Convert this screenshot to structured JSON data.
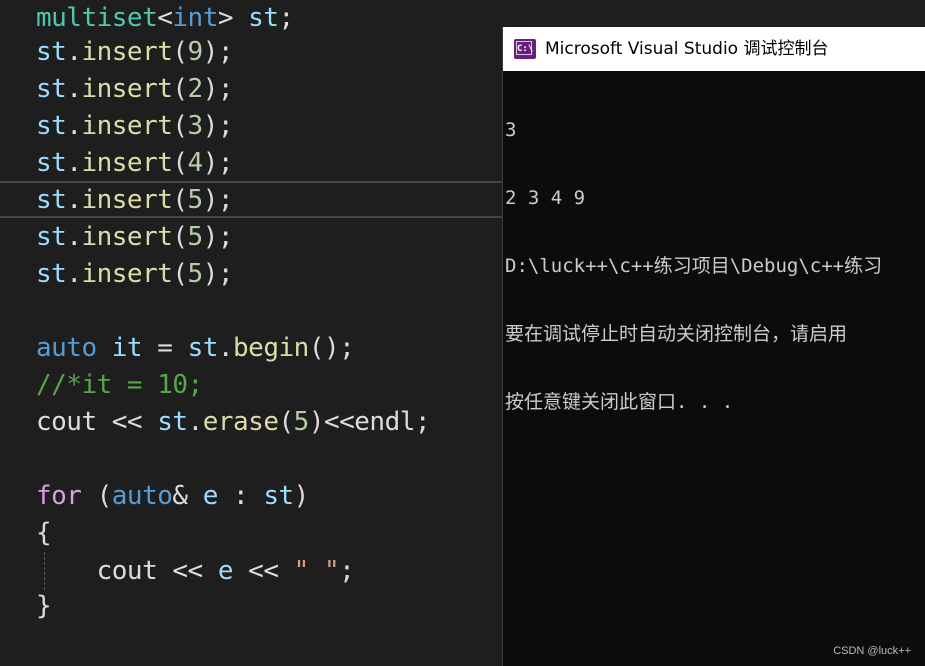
{
  "code_lines": [
    [
      {
        "t": "multiset",
        "c": "type"
      },
      {
        "t": "<",
        "c": "pl"
      },
      {
        "t": "int",
        "c": "kw"
      },
      {
        "t": "> ",
        "c": "pl"
      },
      {
        "t": "st",
        "c": "id"
      },
      {
        "t": ";",
        "c": "pl"
      }
    ],
    [
      {
        "t": "st",
        "c": "id"
      },
      {
        "t": ".",
        "c": "pl"
      },
      {
        "t": "insert",
        "c": "fn"
      },
      {
        "t": "(",
        "c": "pl"
      },
      {
        "t": "9",
        "c": "num"
      },
      {
        "t": ");",
        "c": "pl"
      }
    ],
    [
      {
        "t": "st",
        "c": "id"
      },
      {
        "t": ".",
        "c": "pl"
      },
      {
        "t": "insert",
        "c": "fn"
      },
      {
        "t": "(",
        "c": "pl"
      },
      {
        "t": "2",
        "c": "num"
      },
      {
        "t": ");",
        "c": "pl"
      }
    ],
    [
      {
        "t": "st",
        "c": "id"
      },
      {
        "t": ".",
        "c": "pl"
      },
      {
        "t": "insert",
        "c": "fn"
      },
      {
        "t": "(",
        "c": "pl"
      },
      {
        "t": "3",
        "c": "num"
      },
      {
        "t": ");",
        "c": "pl"
      }
    ],
    [
      {
        "t": "st",
        "c": "id"
      },
      {
        "t": ".",
        "c": "pl"
      },
      {
        "t": "insert",
        "c": "fn"
      },
      {
        "t": "(",
        "c": "pl"
      },
      {
        "t": "4",
        "c": "num"
      },
      {
        "t": ");",
        "c": "pl"
      }
    ],
    [
      {
        "t": "st",
        "c": "id"
      },
      {
        "t": ".",
        "c": "pl"
      },
      {
        "t": "insert",
        "c": "fn"
      },
      {
        "t": "(",
        "c": "pl"
      },
      {
        "t": "5",
        "c": "num"
      },
      {
        "t": ");",
        "c": "pl"
      }
    ],
    [
      {
        "t": "st",
        "c": "id"
      },
      {
        "t": ".",
        "c": "pl"
      },
      {
        "t": "insert",
        "c": "fn"
      },
      {
        "t": "(",
        "c": "pl"
      },
      {
        "t": "5",
        "c": "num"
      },
      {
        "t": ");",
        "c": "pl"
      }
    ],
    [
      {
        "t": "st",
        "c": "id"
      },
      {
        "t": ".",
        "c": "pl"
      },
      {
        "t": "insert",
        "c": "fn"
      },
      {
        "t": "(",
        "c": "pl"
      },
      {
        "t": "5",
        "c": "num"
      },
      {
        "t": ");",
        "c": "pl"
      }
    ],
    [],
    [
      {
        "t": "auto",
        "c": "kw"
      },
      {
        "t": " ",
        "c": "pl"
      },
      {
        "t": "it",
        "c": "id"
      },
      {
        "t": " = ",
        "c": "pl"
      },
      {
        "t": "st",
        "c": "id"
      },
      {
        "t": ".",
        "c": "pl"
      },
      {
        "t": "begin",
        "c": "fn"
      },
      {
        "t": "();",
        "c": "pl"
      }
    ],
    [
      {
        "t": "//*it = 10;",
        "c": "cm"
      }
    ],
    [
      {
        "t": "cout",
        "c": "pl"
      },
      {
        "t": " << ",
        "c": "pl"
      },
      {
        "t": "st",
        "c": "id"
      },
      {
        "t": ".",
        "c": "pl"
      },
      {
        "t": "erase",
        "c": "fn"
      },
      {
        "t": "(",
        "c": "pl"
      },
      {
        "t": "5",
        "c": "num"
      },
      {
        "t": ")<<",
        "c": "pl"
      },
      {
        "t": "endl",
        "c": "pl"
      },
      {
        "t": ";",
        "c": "pl"
      }
    ],
    [],
    [
      {
        "t": "for",
        "c": "ctl"
      },
      {
        "t": " (",
        "c": "pl"
      },
      {
        "t": "auto",
        "c": "kw"
      },
      {
        "t": "& ",
        "c": "pl"
      },
      {
        "t": "e",
        "c": "id"
      },
      {
        "t": " : ",
        "c": "pl"
      },
      {
        "t": "st",
        "c": "id"
      },
      {
        "t": ")",
        "c": "pl"
      }
    ],
    [
      {
        "t": "{",
        "c": "pl"
      }
    ],
    [
      {
        "t": "    cout",
        "c": "pl"
      },
      {
        "t": " << ",
        "c": "pl"
      },
      {
        "t": "e",
        "c": "id"
      },
      {
        "t": " << ",
        "c": "pl"
      },
      {
        "t": "\" \"",
        "c": "str"
      },
      {
        "t": ";",
        "c": "pl"
      }
    ],
    [
      {
        "t": "}",
        "c": "pl"
      }
    ]
  ],
  "console": {
    "title": "Microsoft Visual Studio 调试控制台",
    "icon": "vs-console-icon",
    "icon_text": "C:\\",
    "lines": [
      "3",
      "2 3 4 9",
      "D:\\luck++\\c++练习项目\\Debug\\c++练习",
      "要在调试停止时自动关闭控制台，请启用",
      "按任意键关闭此窗口. . ."
    ]
  },
  "watermark": "CSDN @luck++"
}
